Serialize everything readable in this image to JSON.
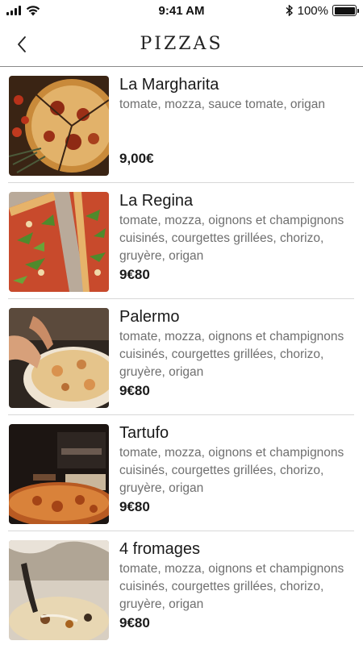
{
  "status_bar": {
    "time": "9:41 AM",
    "battery": "100%"
  },
  "nav": {
    "title": "PIZZAS",
    "back_icon": "chevron-left-icon"
  },
  "items": [
    {
      "name": "La Margharita",
      "description": "tomate, mozza, sauce tomate, origan",
      "price": "9,00€"
    },
    {
      "name": "La Regina",
      "description": "tomate, mozza, oignons et  champignons cuisinés,  courgettes grillées, chorizo, gruyère, origan",
      "price": "9€80"
    },
    {
      "name": "Palermo",
      "description": "tomate, mozza, oignons et  champignons cuisinés,  courgettes grillées, chorizo, gruyère, origan",
      "price": "9€80"
    },
    {
      "name": "Tartufo",
      "description": "tomate, mozza, oignons et  champignons cuisinés,  courgettes grillées, chorizo, gruyère, origan",
      "price": "9€80"
    },
    {
      "name": "4 fromages",
      "description": "tomate, mozza, oignons et  champignons cuisinés,  courgettes grillées, chorizo, gruyère, origan",
      "price": "9€80"
    }
  ]
}
